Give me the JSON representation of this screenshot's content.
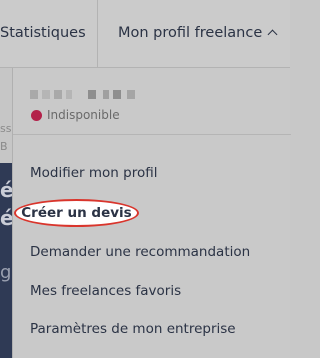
{
  "topnav": {
    "statistics": "Statistiques",
    "profile_menu": "Mon profil freelance",
    "profile_chevron": "chevron-up-icon"
  },
  "background": {
    "frag1": "ss",
    "frag2": "é",
    "frag3": "é",
    "frag4": "g",
    "frag5": "B"
  },
  "dropdown": {
    "status": "Indisponible",
    "status_color": "#b3214a",
    "items": [
      {
        "label": "Modifier mon profil"
      },
      {
        "label": "Créer un devis"
      },
      {
        "label": "Demander une recommandation"
      },
      {
        "label": "Mes freelances favoris"
      },
      {
        "label": "Paramètres de mon entreprise"
      }
    ]
  },
  "colors": {
    "highlight_ring": "#d9352c",
    "text": "#2b3345"
  }
}
